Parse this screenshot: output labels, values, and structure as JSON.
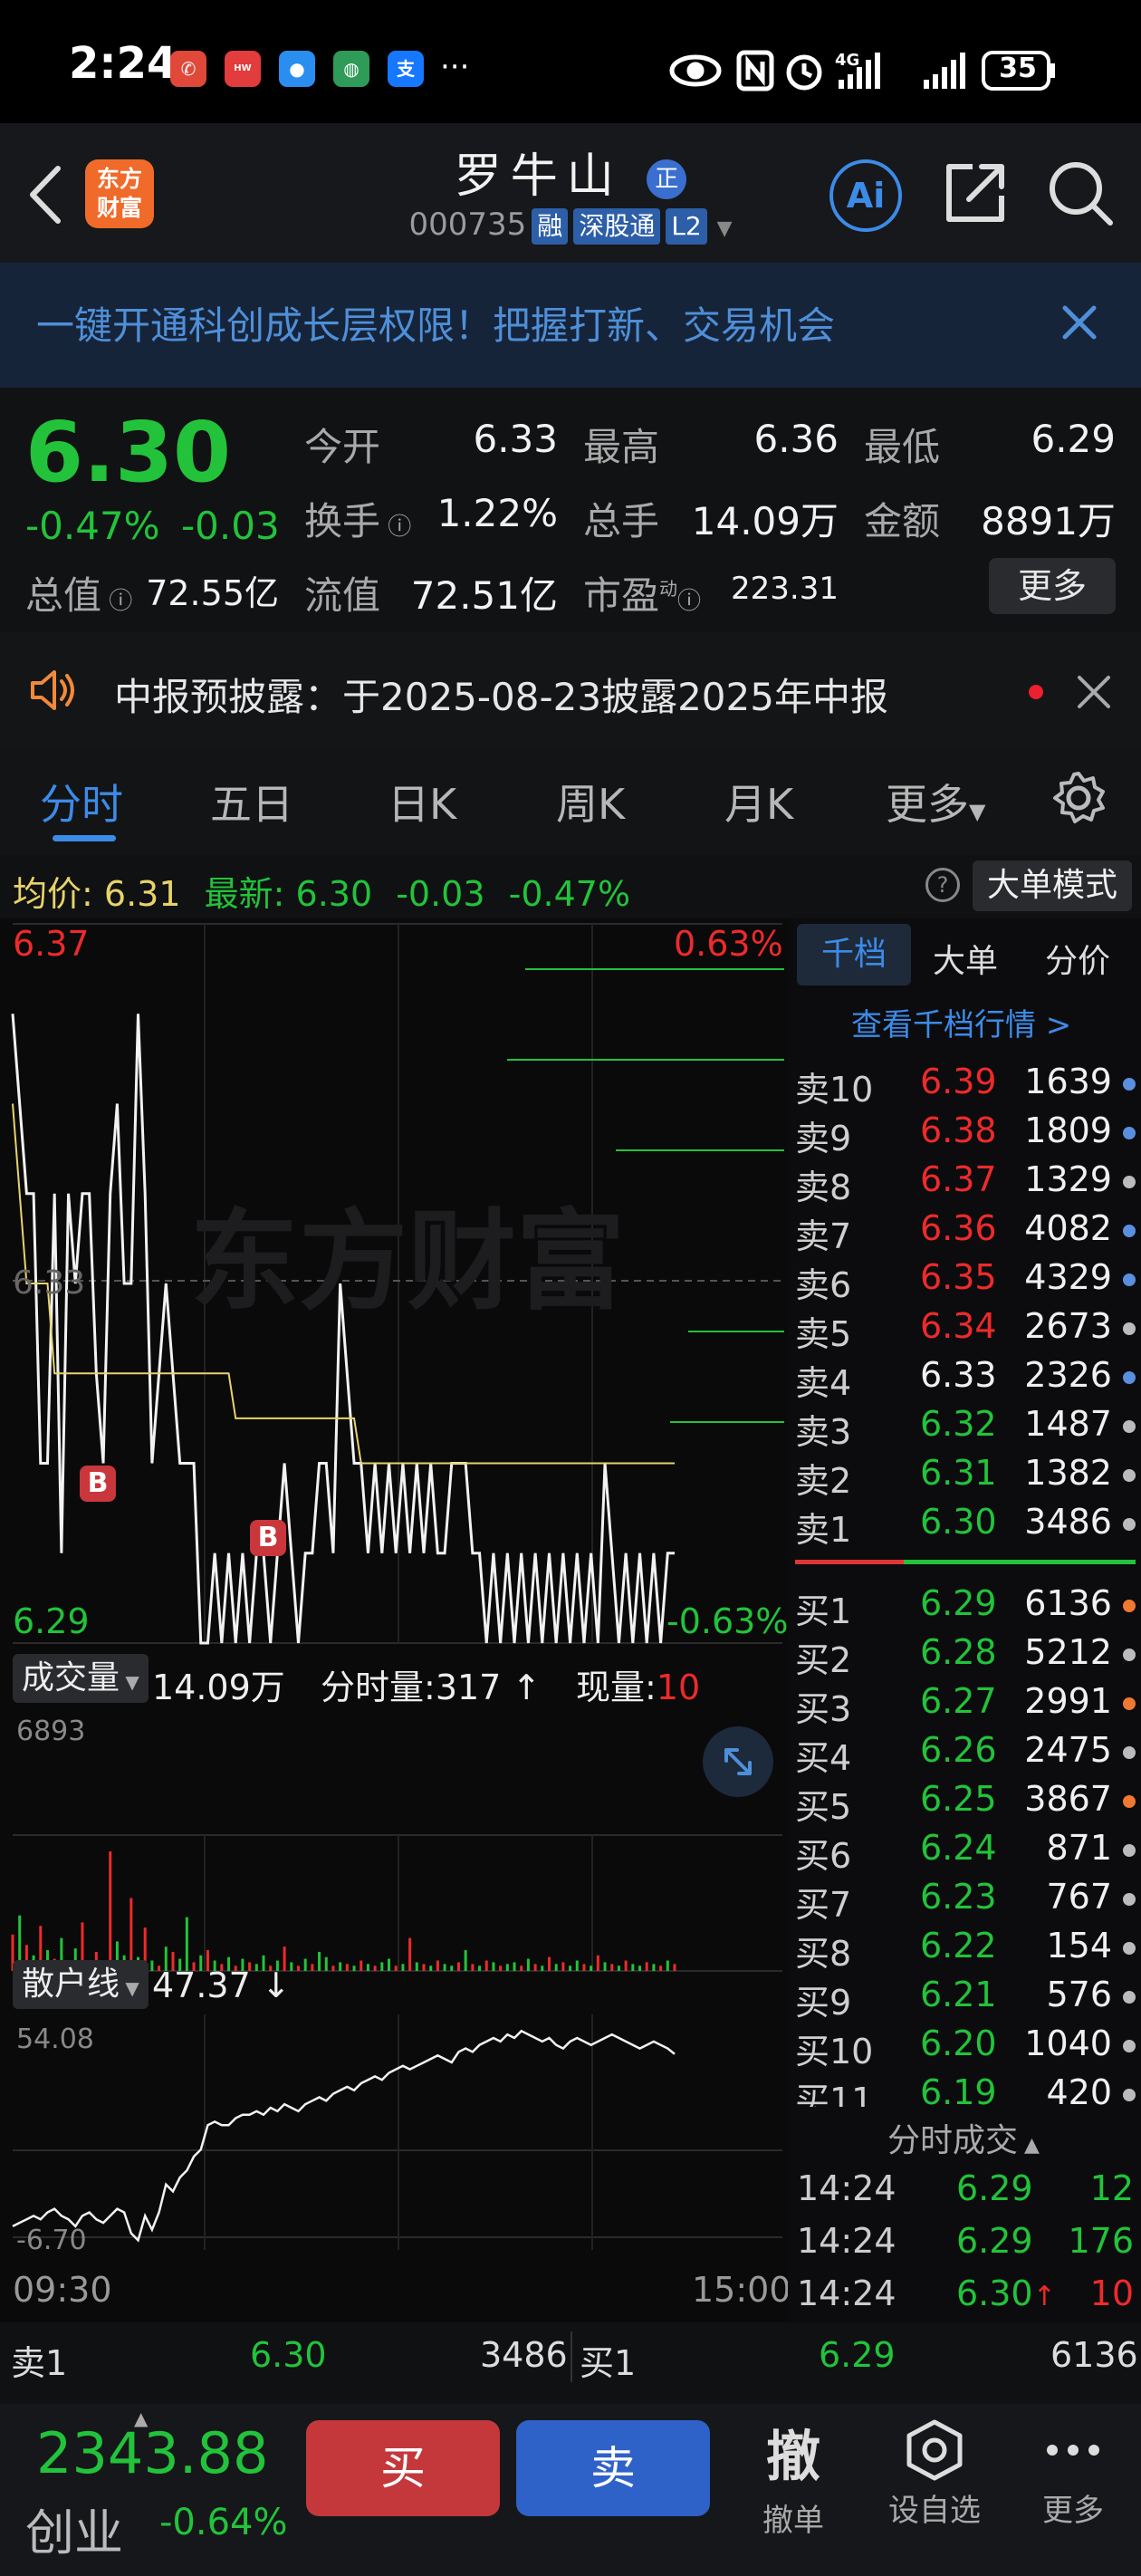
{
  "status_bar": {
    "time": "2:24",
    "battery": "35",
    "network": "4G",
    "more": "···"
  },
  "header": {
    "logo_line1": "东方",
    "logo_line2": "财富",
    "stock_name": "罗牛山",
    "name_badge": "正",
    "stock_code": "000735",
    "tags": [
      "融",
      "深股通",
      "L2"
    ],
    "ai_label": "Ai"
  },
  "banner": {
    "text": "一键开通科创成长层权限！把握打新、交易机会"
  },
  "quote": {
    "price": "6.30",
    "change_pct": "-0.47%",
    "change": "-0.03",
    "stats": [
      {
        "label": "今开",
        "value": "6.33"
      },
      {
        "label": "最高",
        "value": "6.36"
      },
      {
        "label": "最低",
        "value": "6.29"
      },
      {
        "label": "换手",
        "value": "1.22%"
      },
      {
        "label": "总手",
        "value": "14.09万"
      },
      {
        "label": "金额",
        "value": "8891万"
      },
      {
        "label": "总值",
        "value": "72.55亿"
      },
      {
        "label": "流值",
        "value": "72.51亿"
      },
      {
        "label": "市盈",
        "value": "223.31"
      }
    ],
    "pe_sup": "动",
    "more_button": "更多"
  },
  "notice": {
    "text": "中报预披露：于2025-08-23披露2025年中报"
  },
  "tabs": [
    "分时",
    "五日",
    "日K",
    "周K",
    "月K",
    "更多"
  ],
  "avg_row": {
    "avg_label": "均价:",
    "avg_value": "6.31",
    "latest_label": "最新:",
    "latest_value": "6.30",
    "latest_change": "-0.03",
    "latest_pct": "-0.47%",
    "help": "?",
    "big_order_button": "大单模式"
  },
  "chart": {
    "price_high": "6.37",
    "price_low": "6.29",
    "price_mid": "6.33",
    "pct_high": "0.63%",
    "pct_low": "-0.63%",
    "watermark": "东方财富",
    "marker": "B",
    "volume_label": "成交量",
    "volume_total": "14.09万",
    "time_vol_label": "分时量:",
    "time_vol_value": "317",
    "now_vol_label": "现量:",
    "now_vol_value": "10",
    "volume_max": "6893",
    "retail_label": "散户线",
    "retail_value": "47.37",
    "retail_max": "54.08",
    "retail_min": "-6.70",
    "time_start": "09:30",
    "time_end": "15:00"
  },
  "order_book": {
    "tabs": [
      "千档",
      "大单",
      "分价"
    ],
    "link": "查看千档行情 >",
    "asks": [
      {
        "label": "卖10",
        "price": "6.39",
        "vol": "1639",
        "dot": "#5a8fe0"
      },
      {
        "label": "卖9",
        "price": "6.38",
        "vol": "1809",
        "dot": "#5a8fe0"
      },
      {
        "label": "卖8",
        "price": "6.37",
        "vol": "1329",
        "dot": "#bbbbbb"
      },
      {
        "label": "卖7",
        "price": "6.36",
        "vol": "4082",
        "dot": "#5a8fe0"
      },
      {
        "label": "卖6",
        "price": "6.35",
        "vol": "4329",
        "dot": "#5a8fe0"
      },
      {
        "label": "卖5",
        "price": "6.34",
        "vol": "2673",
        "dot": "#bbbbbb"
      },
      {
        "label": "卖4",
        "price": "6.33",
        "vol": "2326",
        "dot": "#5a8fe0"
      },
      {
        "label": "卖3",
        "price": "6.32",
        "vol": "1487",
        "dot": "#bbbbbb"
      },
      {
        "label": "卖2",
        "price": "6.31",
        "vol": "1382",
        "dot": "#bbbbbb"
      },
      {
        "label": "卖1",
        "price": "6.30",
        "vol": "3486",
        "dot": "#bbbbbb"
      }
    ],
    "bids": [
      {
        "label": "买1",
        "price": "6.29",
        "vol": "6136",
        "dot": "#f07830"
      },
      {
        "label": "买2",
        "price": "6.28",
        "vol": "5212",
        "dot": "#bbbbbb"
      },
      {
        "label": "买3",
        "price": "6.27",
        "vol": "2991",
        "dot": "#f07830"
      },
      {
        "label": "买4",
        "price": "6.26",
        "vol": "2475",
        "dot": "#bbbbbb"
      },
      {
        "label": "买5",
        "price": "6.25",
        "vol": "3867",
        "dot": "#f07830"
      },
      {
        "label": "买6",
        "price": "6.24",
        "vol": "871",
        "dot": "#bbbbbb"
      },
      {
        "label": "买7",
        "price": "6.23",
        "vol": "767",
        "dot": "#bbbbbb"
      },
      {
        "label": "买8",
        "price": "6.22",
        "vol": "154",
        "dot": "#bbbbbb"
      },
      {
        "label": "买9",
        "price": "6.21",
        "vol": "576",
        "dot": "#bbbbbb"
      },
      {
        "label": "买10",
        "price": "6.20",
        "vol": "1040",
        "dot": "#bbbbbb"
      },
      {
        "label": "买11",
        "price": "6.19",
        "vol": "420",
        "dot": "#bbbbbb"
      }
    ],
    "trades_title": "分时成交",
    "trades": [
      {
        "time": "14:24",
        "price": "6.29",
        "vol": "12",
        "dir": ""
      },
      {
        "time": "14:24",
        "price": "6.29",
        "vol": "176",
        "dir": ""
      },
      {
        "time": "14:24",
        "price": "6.30",
        "vol": "10",
        "dir": "↑"
      }
    ]
  },
  "bottom_quote": {
    "ask_label": "卖1",
    "ask_price": "6.30",
    "ask_vol": "3486",
    "bid_label": "买1",
    "bid_price": "6.29",
    "bid_vol": "6136"
  },
  "bottom_bar": {
    "index_value": "2343.88",
    "index_name": "创业",
    "index_change": "-0.64%",
    "buy_button": "买",
    "sell_button": "卖",
    "cancel_icon": "撤",
    "cancel_label": "撤单",
    "watchlist_label": "设自选",
    "more_label": "更多"
  },
  "colors": {
    "up": "#ee2a2a",
    "down": "#22c33a",
    "accent": "#2f7fd8",
    "avg_line": "#e7d36a"
  },
  "chart_data": {
    "type": "line",
    "price_axis": [
      6.29,
      6.37
    ],
    "price_ref": 6.33,
    "price_series": [
      6.36,
      6.35,
      6.34,
      6.34,
      6.31,
      6.31,
      6.34,
      6.3,
      6.34,
      6.33,
      6.34,
      6.34,
      6.32,
      6.31,
      6.34,
      6.35,
      6.33,
      6.33,
      6.36,
      6.34,
      6.31,
      6.32,
      6.33,
      6.32,
      6.31,
      6.31,
      6.31,
      6.29,
      6.29,
      6.3,
      6.29,
      6.3,
      6.29,
      6.3,
      6.29,
      6.3,
      6.3,
      6.29,
      6.3,
      6.31,
      6.3,
      6.29,
      6.3,
      6.3,
      6.31,
      6.31,
      6.3,
      6.33,
      6.32,
      6.31,
      6.31,
      6.3,
      6.31,
      6.3,
      6.31,
      6.3,
      6.31,
      6.3,
      6.31,
      6.3,
      6.31,
      6.3,
      6.3,
      6.31,
      6.31,
      6.31,
      6.3,
      6.3,
      6.29,
      6.3,
      6.29,
      6.3,
      6.29,
      6.3,
      6.29,
      6.3,
      6.29,
      6.3,
      6.29,
      6.3,
      6.29,
      6.3,
      6.29,
      6.3,
      6.29,
      6.31,
      6.3,
      6.29,
      6.3,
      6.29,
      6.3,
      6.29,
      6.3,
      6.29,
      6.3,
      6.3
    ],
    "avg_series": [
      6.35,
      6.34,
      6.33,
      6.33,
      6.33,
      6.33,
      6.32,
      6.32,
      6.32,
      6.32,
      6.32,
      6.32,
      6.32,
      6.32,
      6.32,
      6.32,
      6.32,
      6.32,
      6.32,
      6.32,
      6.32,
      6.32,
      6.32,
      6.32,
      6.32,
      6.32,
      6.32,
      6.32,
      6.32,
      6.32,
      6.32,
      6.32,
      6.315,
      6.315,
      6.315,
      6.315,
      6.315,
      6.315,
      6.315,
      6.315,
      6.315,
      6.315,
      6.315,
      6.315,
      6.315,
      6.315,
      6.315,
      6.315,
      6.315,
      6.315,
      6.31,
      6.31,
      6.31,
      6.31,
      6.31,
      6.31,
      6.31,
      6.31,
      6.31,
      6.31,
      6.31,
      6.31,
      6.31,
      6.31,
      6.31,
      6.31,
      6.31,
      6.31,
      6.31,
      6.31,
      6.31,
      6.31,
      6.31,
      6.31,
      6.31,
      6.31,
      6.31,
      6.31,
      6.31,
      6.31,
      6.31,
      6.31,
      6.31,
      6.31,
      6.31,
      6.31,
      6.31,
      6.31,
      6.31,
      6.31,
      6.31,
      6.31,
      6.31,
      6.31,
      6.31,
      6.31
    ],
    "volume_max": 6893,
    "volume_series": [
      2100,
      3200,
      1500,
      900,
      2600,
      1200,
      700,
      1900,
      500,
      1300,
      2800,
      600,
      1100,
      400,
      6893,
      1700,
      900,
      4200,
      800,
      2500,
      600,
      300,
      1400,
      1100,
      700,
      3100,
      500,
      900,
      1200,
      600,
      400,
      800,
      300,
      700,
      500,
      400,
      900,
      300,
      600,
      1400,
      500,
      300,
      700,
      400,
      1100,
      800,
      300,
      500,
      400,
      300,
      600,
      400,
      300,
      500,
      700,
      300,
      400,
      1900,
      500,
      400,
      300,
      600,
      400,
      300,
      500,
      1200,
      400,
      300,
      600,
      500,
      300,
      400,
      500,
      300,
      700,
      400,
      300,
      800,
      400,
      500,
      300,
      600,
      400,
      300,
      900,
      500,
      400,
      300,
      600,
      400,
      300,
      500,
      400,
      300,
      600,
      400
    ],
    "volume_up": [
      1,
      0,
      1,
      0,
      1,
      0,
      1,
      0,
      1,
      0,
      1,
      0,
      1,
      0,
      1,
      0,
      0,
      1,
      0,
      1,
      0,
      1,
      0,
      1,
      0,
      0,
      1,
      0,
      1,
      0,
      1,
      0,
      1,
      0,
      1,
      0,
      0,
      1,
      0,
      1,
      0,
      1,
      0,
      1,
      0,
      0,
      1,
      0,
      1,
      0,
      1,
      0,
      1,
      0,
      0,
      1,
      0,
      1,
      0,
      1,
      0,
      1,
      0,
      0,
      1,
      0,
      1,
      0,
      1,
      0,
      1,
      0,
      0,
      1,
      0,
      1,
      0,
      1,
      0,
      1,
      0,
      0,
      1,
      0,
      1,
      0,
      1,
      0,
      1,
      0,
      0,
      1,
      0,
      1,
      0,
      1
    ],
    "retail_axis": [
      -6.7,
      54.08
    ],
    "retail_series": [
      -2,
      -1,
      0,
      1,
      0,
      2,
      3,
      1,
      0,
      -2,
      1,
      2,
      0,
      -1,
      1,
      3,
      2,
      -4,
      -6,
      1,
      -3,
      2,
      10,
      8,
      12,
      14,
      18,
      20,
      27,
      28,
      27,
      27,
      29,
      30,
      30,
      31,
      30,
      32,
      31,
      33,
      32,
      31,
      33,
      34,
      35,
      34,
      36,
      37,
      38,
      37,
      39,
      40,
      41,
      40,
      42,
      43,
      44,
      43,
      44,
      45,
      46,
      47,
      46,
      45,
      48,
      49,
      48,
      50,
      51,
      52,
      51,
      53,
      52,
      54,
      53,
      52,
      51,
      52,
      50,
      49,
      51,
      52,
      51,
      50,
      51,
      52,
      53,
      52,
      51,
      50,
      49,
      50,
      51,
      50,
      49,
      47.4
    ]
  }
}
